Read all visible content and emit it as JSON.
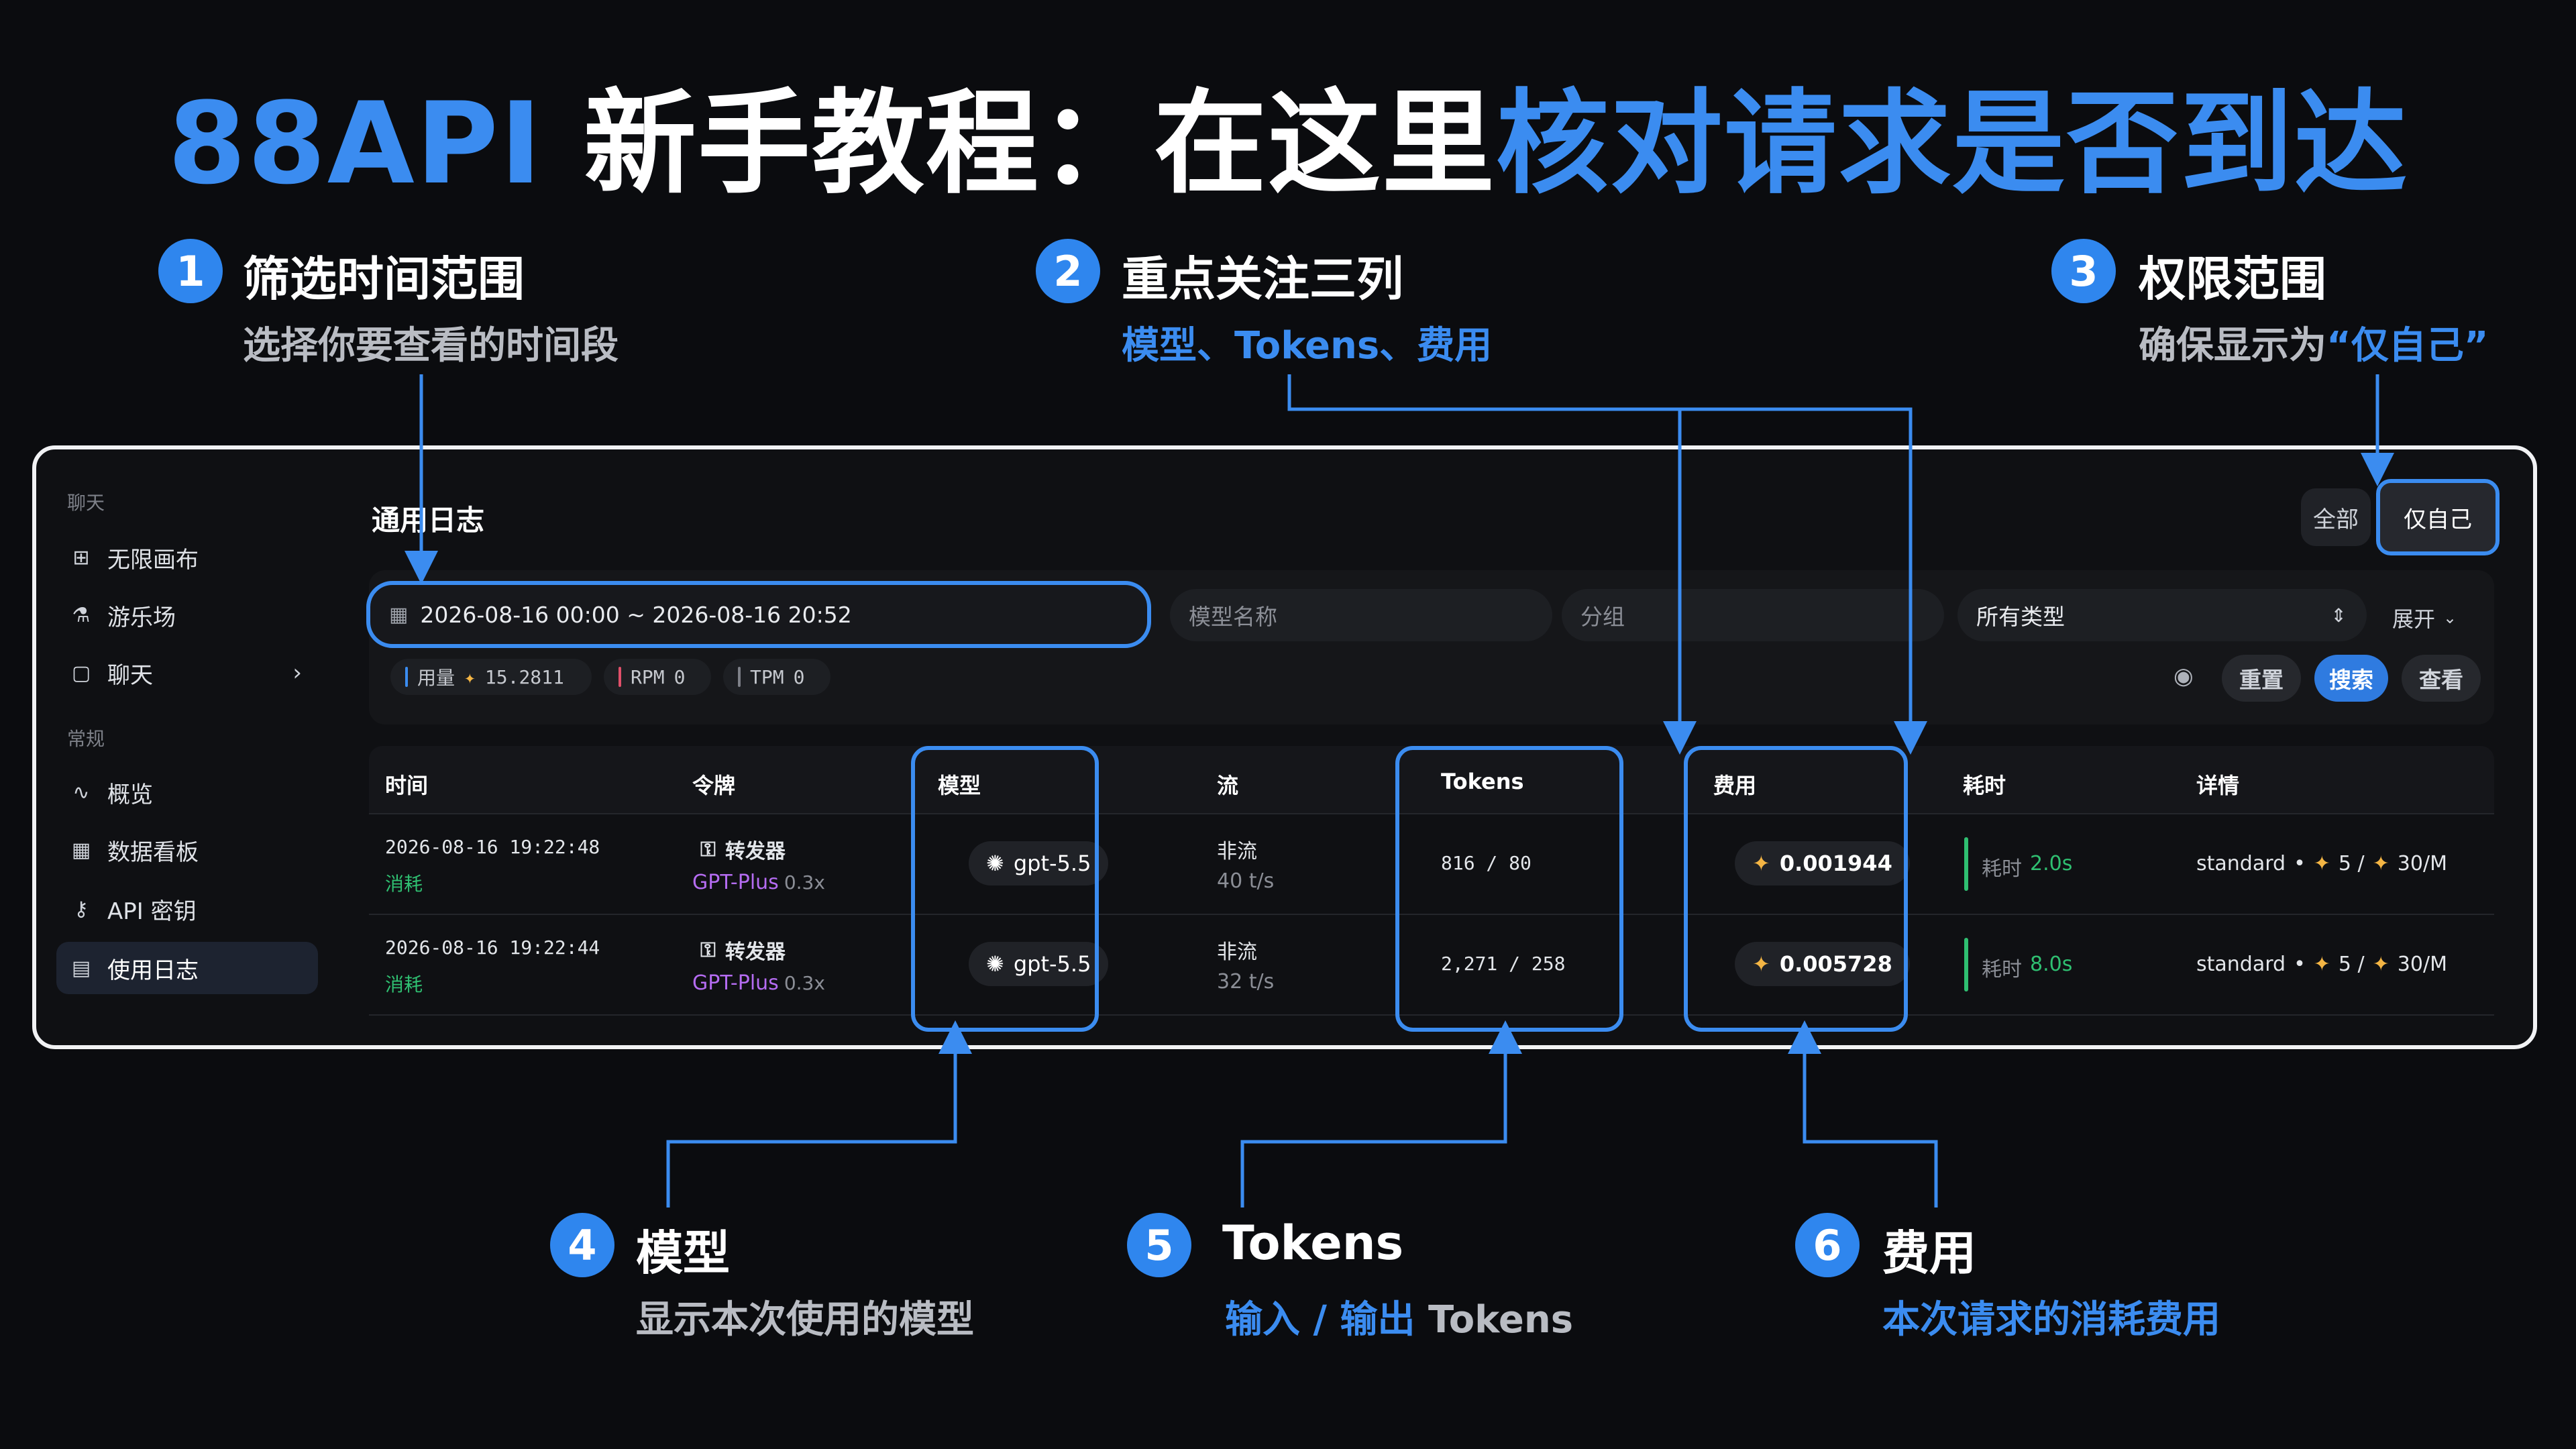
{
  "hero": {
    "part1": "88API",
    "part2": " 新手教程：在这里",
    "part3": "核对请求是否到达"
  },
  "callouts": {
    "c1": {
      "num": "1",
      "title": "筛选时间范围",
      "sub": "选择你要查看的时间段"
    },
    "c2": {
      "num": "2",
      "title": "重点关注三列",
      "sub": "模型、Tokens、费用"
    },
    "c3": {
      "num": "3",
      "title": "权限范围",
      "sub_prefix": "确保显示为",
      "sub_highlight": "“仅自己”"
    },
    "c4": {
      "num": "4",
      "title": "模型",
      "sub": "显示本次使用的模型"
    },
    "c5": {
      "num": "5",
      "title": "Tokens",
      "sub_a": "输入 / 输出",
      "sub_b": " Tokens"
    },
    "c6": {
      "num": "6",
      "title": "费用",
      "sub": "本次请求的消耗费用"
    }
  },
  "sidebar": {
    "group_chat": "聊天",
    "group_general": "常规",
    "items": [
      {
        "label": "无限画布",
        "icon": "canvas-icon"
      },
      {
        "label": "游乐场",
        "icon": "flask-icon"
      },
      {
        "label": "聊天",
        "icon": "chat-icon"
      },
      {
        "label": "概览",
        "icon": "pulse-icon"
      },
      {
        "label": "数据看板",
        "icon": "grid-icon"
      },
      {
        "label": "API 密钥",
        "icon": "key-icon"
      },
      {
        "label": "使用日志",
        "icon": "document-icon"
      }
    ]
  },
  "page": {
    "title": "通用日志",
    "scope_all": "全部",
    "scope_self": "仅自己"
  },
  "filters": {
    "date_range": "2026-08-16 00:00 ~ 2026-08-16 20:52",
    "model_placeholder": "模型名称",
    "group_placeholder": "分组",
    "type_value": "所有类型",
    "expand": "展开"
  },
  "stats": {
    "usage_label": "用量",
    "usage_value": "15.2811",
    "rpm_label": "RPM",
    "rpm_value": "0",
    "tpm_label": "TPM",
    "tpm_value": "0"
  },
  "actions": {
    "reset": "重置",
    "search": "搜索",
    "view": "查看"
  },
  "table": {
    "headers": {
      "time": "时间",
      "token": "令牌",
      "model": "模型",
      "stream": "流",
      "tokens": "Tokens",
      "cost": "费用",
      "duration": "耗时",
      "detail": "详情"
    },
    "rows": [
      {
        "time": "2026-08-16 19:22:48",
        "type": "消耗",
        "token_name": "转发器",
        "group": "GPT-Plus",
        "ratio": "0.3x",
        "model": "gpt-5.5",
        "stream": "非流",
        "speed": "40 t/s",
        "tokens": "816 / 80",
        "cost": "0.001944",
        "duration_label": "耗时",
        "duration_value": "2.0s",
        "detail_a": "standard",
        "detail_b": "5 /",
        "detail_c": "30/M"
      },
      {
        "time": "2026-08-16 19:22:44",
        "type": "消耗",
        "token_name": "转发器",
        "group": "GPT-Plus",
        "ratio": "0.3x",
        "model": "gpt-5.5",
        "stream": "非流",
        "speed": "32 t/s",
        "tokens": "2,271 / 258",
        "cost": "0.005728",
        "duration_label": "耗时",
        "duration_value": "8.0s",
        "detail_a": "standard",
        "detail_b": "5 /",
        "detail_c": "30/M"
      }
    ]
  },
  "colors": {
    "accent": "#3b8cf0",
    "green": "#2fbf71",
    "purple": "#b56cf2",
    "gold": "#f4b544"
  }
}
